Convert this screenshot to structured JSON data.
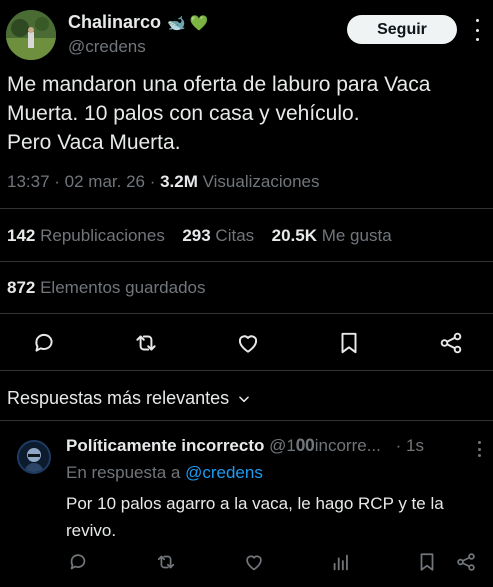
{
  "author": {
    "name": "Chalinarco",
    "emojis": "🐋 💚",
    "handle": "@credens",
    "follow_label": "Seguir"
  },
  "tweet": {
    "lines": [
      "Me mandaron una oferta de laburo para Vaca",
      "Muerta. 10 palos con casa y vehículo.",
      "Pero Vaca Muerta."
    ],
    "time": "13:37 · 02 mar. 26 · ",
    "views_count": "3.2M",
    "views_label": " Visualizaciones"
  },
  "stats": {
    "reposts_count": "142",
    "reposts_label": " Republicaciones",
    "quotes_count": "293",
    "quotes_label": " Citas",
    "likes_count": "20.5K",
    "likes_label": " Me gusta",
    "bookmarks_count": "872",
    "bookmarks_label": " Elementos guardados"
  },
  "actions": {
    "icons": [
      "reply-icon",
      "repost-icon",
      "like-icon",
      "bookmark-icon",
      "share-icon"
    ]
  },
  "replies_header": {
    "label": "Respuestas más relevantes"
  },
  "reply": {
    "name": "Políticamente incorrecto",
    "handle": "@1𝟎𝟎incorre...",
    "time": "· 1s",
    "replying_prefix": "En respuesta a ",
    "replying_to": "@credens",
    "text": "Por 10 palos agarro a la vaca, le hago RCP y te la revivo."
  },
  "colors": {
    "background": "#000000",
    "text": "#e7e9ea",
    "muted": "#71767b",
    "link": "#1d9bf0",
    "divider": "#2f3336",
    "follow_bg": "#eff3f4"
  }
}
